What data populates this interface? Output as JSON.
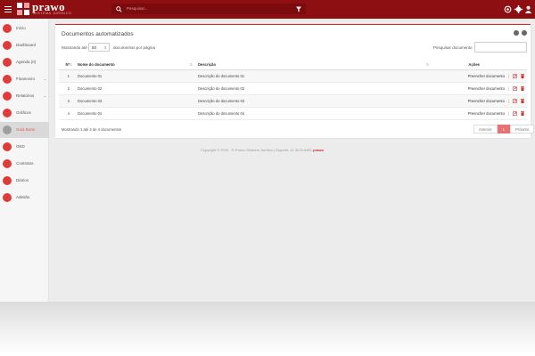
{
  "brand": {
    "name": "prawo",
    "tagline": "SISTEMA JURÍDICO"
  },
  "topbar": {
    "search_placeholder": "Pesquisar..."
  },
  "sidebar": {
    "items": [
      {
        "label": "Início",
        "icon": "home-icon"
      },
      {
        "label": "Dashboard",
        "icon": "dashboard-icon"
      },
      {
        "label": "Agenda (0)",
        "icon": "calendar-icon"
      },
      {
        "label": "Financeiro",
        "icon": "dollar-icon",
        "has_submenu": true
      },
      {
        "label": "Relatórios",
        "icon": "reports-icon",
        "has_submenu": true
      },
      {
        "label": "Gráficos",
        "icon": "chart-icon"
      },
      {
        "label": "Guia Boas",
        "icon": "guide-icon",
        "active": true
      },
      {
        "label": "GED",
        "icon": "documents-icon"
      },
      {
        "label": "Contratos",
        "icon": "contracts-icon"
      },
      {
        "label": "Diários",
        "icon": "newspaper-icon"
      },
      {
        "label": "Adesão",
        "icon": "membership-icon"
      }
    ]
  },
  "card": {
    "title": "Documentos automatizados",
    "show_label": "Mostrando até",
    "page_size": "50",
    "show_after": "documentos por página",
    "search_label": "Pesquisar documento",
    "columns": [
      "Nº",
      "Nome do documento",
      "Descrição",
      "Ações"
    ],
    "rows": [
      {
        "num": "1",
        "name": "Documento 01",
        "desc": "Descrição do documento 01",
        "action": "Preencher documento"
      },
      {
        "num": "2",
        "name": "Documento 02",
        "desc": "Descrição do documento 02",
        "action": "Preencher documento"
      },
      {
        "num": "3",
        "name": "Documento 03",
        "desc": "Descrição do documento 03",
        "action": "Preencher documento"
      },
      {
        "num": "4",
        "name": "Documento 04",
        "desc": "Descrição do documento 04",
        "action": "Preencher documento"
      }
    ],
    "info": "Mostrando 1 até 4 de 4 documentos",
    "pager": {
      "prev": "Anterior",
      "current": "1",
      "next": "Próximo"
    }
  },
  "footer": {
    "copyright": "Copyright © 2020 - ® Prawo Sistema Jurídico | Suporte: 41 3075-6491",
    "mini_logo": "prawo"
  },
  "colors": {
    "brand": "#8e0f12",
    "accent": "#c92a2a",
    "active_page": "#e57373"
  }
}
